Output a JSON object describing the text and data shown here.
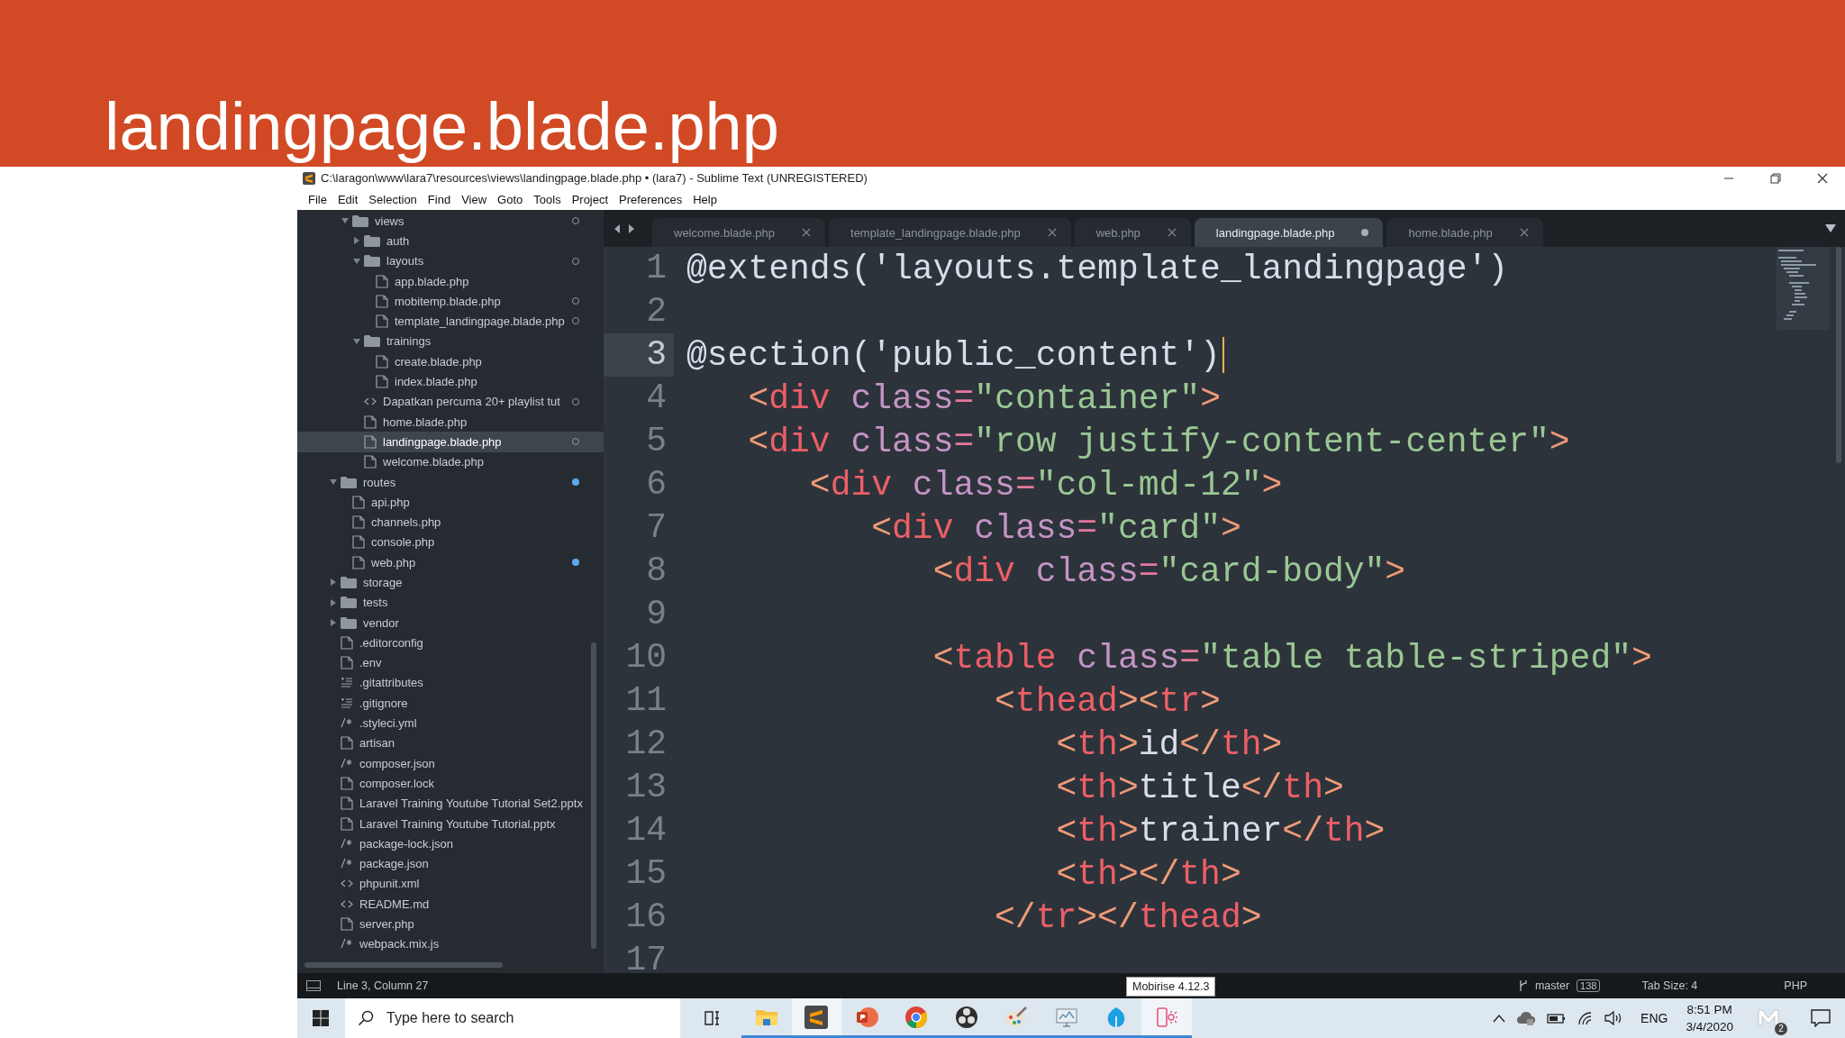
{
  "slide": {
    "title": "landingpage.blade.php"
  },
  "window": {
    "title": "C:\\laragon\\www\\lara7\\resources\\views\\landingpage.blade.php • (lara7) - Sublime Text (UNREGISTERED)",
    "menu": [
      "File",
      "Edit",
      "Selection",
      "Find",
      "View",
      "Goto",
      "Tools",
      "Project",
      "Preferences",
      "Help"
    ]
  },
  "sidebar": {
    "tree": [
      {
        "kind": "hidden",
        "children": [
          {
            "name": "views",
            "kind": "folder",
            "expanded": true,
            "selected": false,
            "status": {
              "kind": "untracked"
            },
            "children": [
              {
                "name": "auth",
                "kind": "folder",
                "expanded": false,
                "selected": false
              },
              {
                "name": "layouts",
                "kind": "folder",
                "expanded": true,
                "selected": false,
                "status": {
                  "kind": "untracked"
                },
                "children": [
                  {
                    "name": "app.blade.php",
                    "kind": "file",
                    "selected": false
                  },
                  {
                    "name": "mobitemp.blade.php",
                    "kind": "file",
                    "selected": false,
                    "status": {
                      "kind": "untracked"
                    }
                  },
                  {
                    "name": "template_landingpage.blade.php",
                    "kind": "file",
                    "selected": false,
                    "status": {
                      "kind": "untracked"
                    }
                  }
                ]
              },
              {
                "name": "trainings",
                "kind": "folder",
                "expanded": true,
                "selected": false,
                "children": [
                  {
                    "name": "create.blade.php",
                    "kind": "file",
                    "selected": false
                  },
                  {
                    "name": "index.blade.php",
                    "kind": "file",
                    "selected": false
                  }
                ]
              },
              {
                "name": "Dapatkan percuma 20+ playlist tut",
                "kind": "markup",
                "selected": false,
                "status": {
                  "kind": "untracked"
                }
              },
              {
                "name": "home.blade.php",
                "kind": "file",
                "selected": false
              },
              {
                "name": "landingpage.blade.php",
                "kind": "file",
                "selected": true,
                "status": {
                  "kind": "untracked"
                }
              },
              {
                "name": "welcome.blade.php",
                "kind": "file",
                "selected": false
              }
            ]
          }
        ]
      },
      {
        "name": "routes",
        "kind": "folder",
        "expanded": true,
        "selected": false,
        "status": {
          "kind": "modified"
        },
        "children": [
          {
            "name": "api.php",
            "kind": "file",
            "selected": false
          },
          {
            "name": "channels.php",
            "kind": "file",
            "selected": false
          },
          {
            "name": "console.php",
            "kind": "file",
            "selected": false
          },
          {
            "name": "web.php",
            "kind": "file",
            "selected": false,
            "status": {
              "kind": "modified"
            }
          }
        ]
      },
      {
        "name": "storage",
        "kind": "folder",
        "expanded": false,
        "selected": false
      },
      {
        "name": "tests",
        "kind": "folder",
        "expanded": false,
        "selected": false
      },
      {
        "name": "vendor",
        "kind": "folder",
        "expanded": false,
        "selected": false
      },
      {
        "name": ".editorconfig",
        "kind": "file",
        "selected": false
      },
      {
        "name": ".env",
        "kind": "file",
        "selected": false
      },
      {
        "name": ".gitattributes",
        "kind": "lines",
        "selected": false
      },
      {
        "name": ".gitignore",
        "kind": "lines",
        "selected": false
      },
      {
        "name": ".styleci.yml",
        "kind": "comment",
        "selected": false
      },
      {
        "name": "artisan",
        "kind": "file",
        "selected": false
      },
      {
        "name": "composer.json",
        "kind": "comment",
        "selected": false
      },
      {
        "name": "composer.lock",
        "kind": "file",
        "selected": false
      },
      {
        "name": "Laravel Training Youtube Tutorial Set2.pptx",
        "kind": "file",
        "selected": false
      },
      {
        "name": "Laravel Training Youtube Tutorial.pptx",
        "kind": "file",
        "selected": false
      },
      {
        "name": "package-lock.json",
        "kind": "comment",
        "selected": false
      },
      {
        "name": "package.json",
        "kind": "comment",
        "selected": false
      },
      {
        "name": "phpunit.xml",
        "kind": "markup",
        "selected": false
      },
      {
        "name": "README.md",
        "kind": "markup",
        "selected": false
      },
      {
        "name": "server.php",
        "kind": "file",
        "selected": false
      },
      {
        "name": "webpack.mix.js",
        "kind": "comment",
        "selected": false
      }
    ]
  },
  "tabs": [
    {
      "label": "welcome.blade.php",
      "selected": false,
      "modified": false
    },
    {
      "label": "template_landingpage.blade.php",
      "selected": false,
      "modified": false
    },
    {
      "label": "web.php",
      "selected": false,
      "modified": false
    },
    {
      "label": "landingpage.blade.php",
      "selected": true,
      "modified": true
    },
    {
      "label": "home.blade.php",
      "selected": false,
      "modified": false
    }
  ],
  "code": [
    {
      "number": "1",
      "current": false,
      "tokens": [
        {
          "kind": "plain",
          "text": "@extends('layouts.template_landingpage')"
        }
      ]
    },
    {
      "number": "2",
      "current": false
    },
    {
      "number": "3",
      "current": true,
      "tokens": [
        {
          "kind": "plain",
          "text": "@section('public_content')"
        }
      ]
    },
    {
      "number": "4",
      "current": false,
      "tokens": [
        {
          "kind": "punct",
          "text": "   <"
        },
        {
          "kind": "tag",
          "text": "div"
        },
        {
          "kind": "attr",
          "text": " class"
        },
        {
          "kind": "op",
          "text": "="
        },
        {
          "kind": "str",
          "text": "\"container\""
        },
        {
          "kind": "punct",
          "text": ">"
        }
      ]
    },
    {
      "number": "5",
      "current": false,
      "tokens": [
        {
          "kind": "punct",
          "text": "   <"
        },
        {
          "kind": "tag",
          "text": "div"
        },
        {
          "kind": "attr",
          "text": " class"
        },
        {
          "kind": "op",
          "text": "="
        },
        {
          "kind": "str",
          "text": "\"row justify-content-center\""
        },
        {
          "kind": "punct",
          "text": ">"
        }
      ]
    },
    {
      "number": "6",
      "current": false,
      "tokens": [
        {
          "kind": "punct",
          "text": "      <"
        },
        {
          "kind": "tag",
          "text": "div"
        },
        {
          "kind": "attr",
          "text": " class"
        },
        {
          "kind": "op",
          "text": "="
        },
        {
          "kind": "str",
          "text": "\"col-md-12\""
        },
        {
          "kind": "punct",
          "text": ">"
        }
      ]
    },
    {
      "number": "7",
      "current": false,
      "tokens": [
        {
          "kind": "punct",
          "text": "         <"
        },
        {
          "kind": "tag",
          "text": "div"
        },
        {
          "kind": "attr",
          "text": " class"
        },
        {
          "kind": "op",
          "text": "="
        },
        {
          "kind": "str",
          "text": "\"card\""
        },
        {
          "kind": "punct",
          "text": ">"
        }
      ]
    },
    {
      "number": "8",
      "current": false,
      "tokens": [
        {
          "kind": "punct",
          "text": "            <"
        },
        {
          "kind": "tag",
          "text": "div"
        },
        {
          "kind": "attr",
          "text": " class"
        },
        {
          "kind": "op",
          "text": "="
        },
        {
          "kind": "str",
          "text": "\"card-body\""
        },
        {
          "kind": "punct",
          "text": ">"
        }
      ]
    },
    {
      "number": "9",
      "current": false
    },
    {
      "number": "10",
      "current": false,
      "tokens": [
        {
          "kind": "punct",
          "text": "            <"
        },
        {
          "kind": "tag",
          "text": "table"
        },
        {
          "kind": "attr",
          "text": " class"
        },
        {
          "kind": "op",
          "text": "="
        },
        {
          "kind": "str",
          "text": "\"table table-striped\""
        },
        {
          "kind": "punct",
          "text": ">"
        }
      ]
    },
    {
      "number": "11",
      "current": false,
      "tokens": [
        {
          "kind": "punct",
          "text": "               <"
        },
        {
          "kind": "tag",
          "text": "thead"
        },
        {
          "kind": "punct",
          "text": "><"
        },
        {
          "kind": "tag",
          "text": "tr"
        },
        {
          "kind": "punct",
          "text": ">"
        }
      ]
    },
    {
      "number": "12",
      "current": false,
      "tokens": [
        {
          "kind": "punct",
          "text": "                  <"
        },
        {
          "kind": "tag",
          "text": "th"
        },
        {
          "kind": "punct",
          "text": ">"
        },
        {
          "kind": "plain",
          "text": "id"
        },
        {
          "kind": "punct",
          "text": "</"
        },
        {
          "kind": "tag",
          "text": "th"
        },
        {
          "kind": "punct",
          "text": ">"
        }
      ]
    },
    {
      "number": "13",
      "current": false,
      "tokens": [
        {
          "kind": "punct",
          "text": "                  <"
        },
        {
          "kind": "tag",
          "text": "th"
        },
        {
          "kind": "punct",
          "text": ">"
        },
        {
          "kind": "plain",
          "text": "title"
        },
        {
          "kind": "punct",
          "text": "</"
        },
        {
          "kind": "tag",
          "text": "th"
        },
        {
          "kind": "punct",
          "text": ">"
        }
      ]
    },
    {
      "number": "14",
      "current": false,
      "tokens": [
        {
          "kind": "punct",
          "text": "                  <"
        },
        {
          "kind": "tag",
          "text": "th"
        },
        {
          "kind": "punct",
          "text": ">"
        },
        {
          "kind": "plain",
          "text": "trainer"
        },
        {
          "kind": "punct",
          "text": "</"
        },
        {
          "kind": "tag",
          "text": "th"
        },
        {
          "kind": "punct",
          "text": ">"
        }
      ]
    },
    {
      "number": "15",
      "current": false,
      "tokens": [
        {
          "kind": "punct",
          "text": "                  <"
        },
        {
          "kind": "tag",
          "text": "th"
        },
        {
          "kind": "punct",
          "text": "></"
        },
        {
          "kind": "tag",
          "text": "th"
        },
        {
          "kind": "punct",
          "text": ">"
        }
      ]
    },
    {
      "number": "16",
      "current": false,
      "tokens": [
        {
          "kind": "punct",
          "text": "               </"
        },
        {
          "kind": "tag",
          "text": "tr"
        },
        {
          "kind": "punct",
          "text": "></"
        },
        {
          "kind": "tag",
          "text": "thead"
        },
        {
          "kind": "punct",
          "text": ">"
        }
      ]
    },
    {
      "number": "17",
      "current": false
    }
  ],
  "status_bar": {
    "position": "Line 3, Column 27",
    "tooltip": "Mobirise 4.12.3",
    "branch": "master",
    "changes": "138",
    "tab_size": "Tab Size: 4",
    "syntax": "PHP"
  },
  "taskbar": {
    "search_placeholder": "Type here to search",
    "apps": [
      {
        "kind": "folder",
        "active": false
      },
      {
        "kind": "sublime",
        "active": true
      },
      {
        "kind": "powerpoint",
        "active": false
      },
      {
        "kind": "chrome",
        "active": false
      },
      {
        "kind": "obs",
        "active": false
      },
      {
        "kind": "paint",
        "active": false
      },
      {
        "kind": "monitor",
        "active": false
      },
      {
        "kind": "drop",
        "active": false
      },
      {
        "kind": "phone",
        "active": true
      }
    ],
    "language": "ENG",
    "time": "8:51 PM",
    "date": "3/4/2020",
    "notification_count": "2"
  }
}
